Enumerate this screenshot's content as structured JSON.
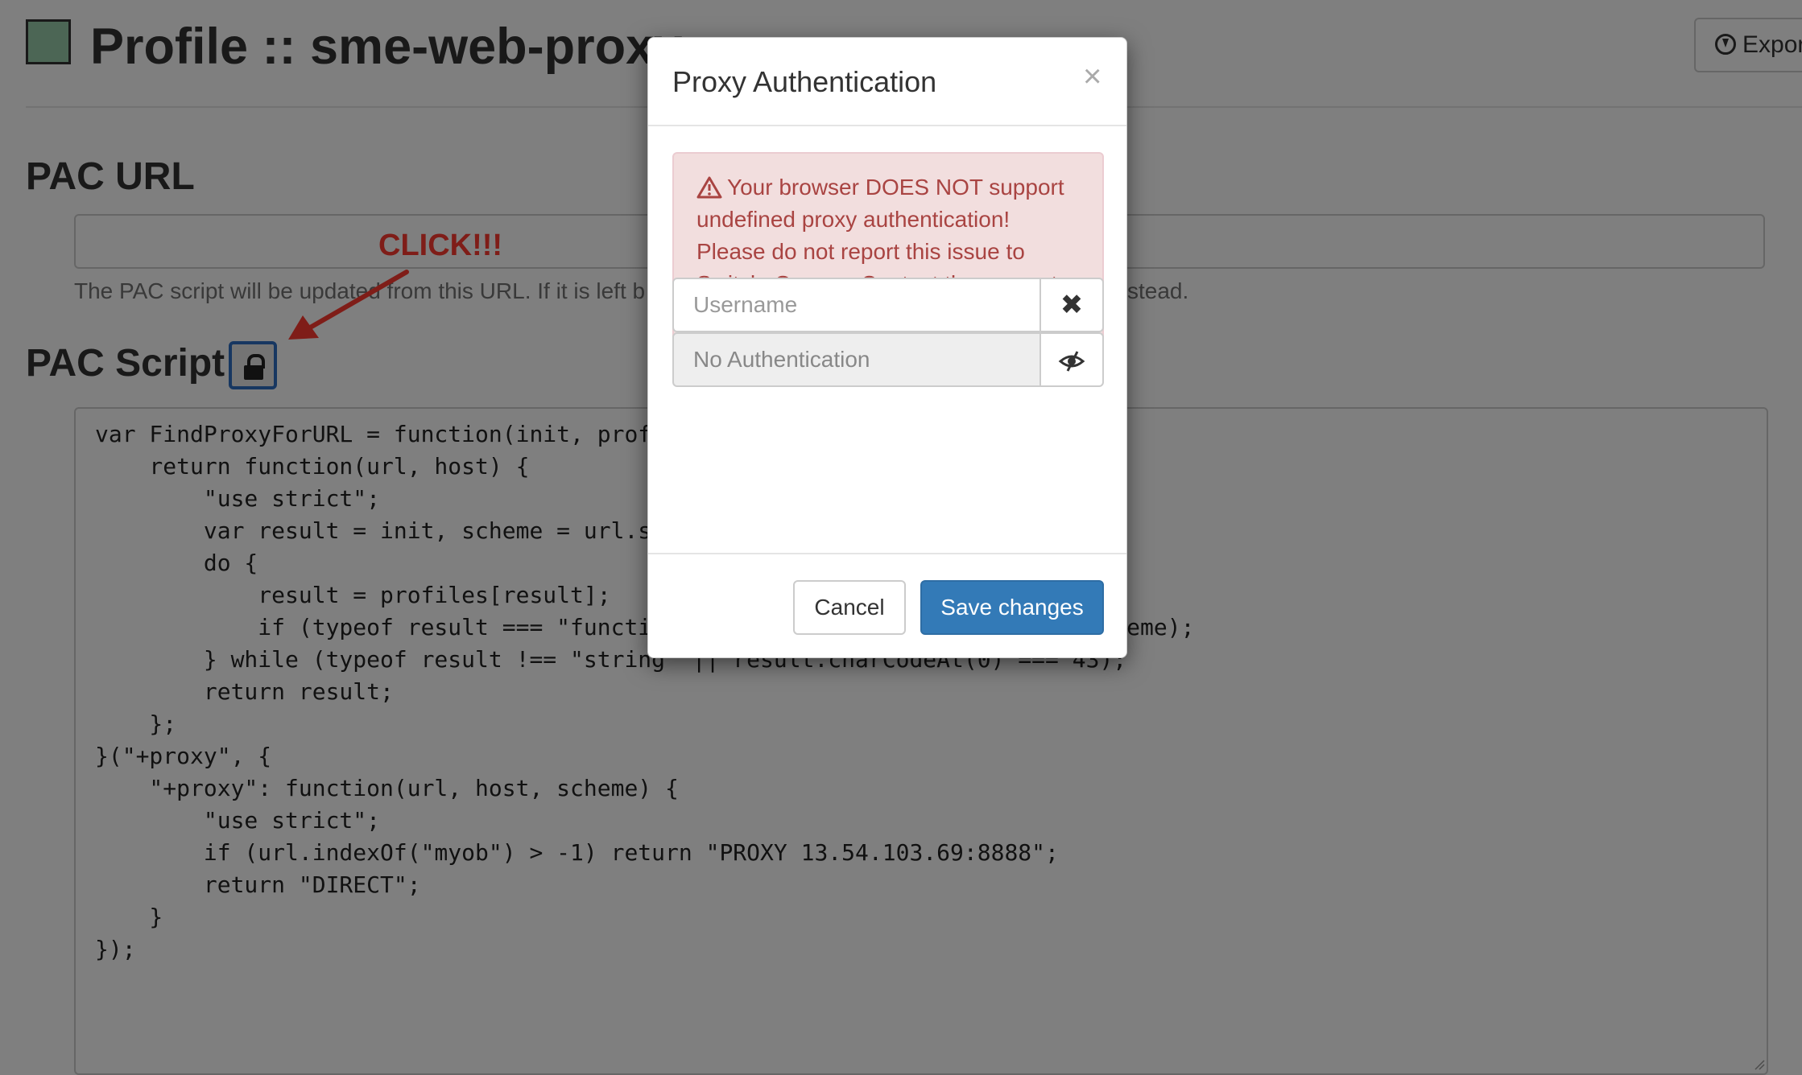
{
  "header": {
    "title": "Profile :: sme-web-proxy",
    "profile_color": "#99ccaa",
    "export_label": "Expor",
    "export_icon": "download-circle-icon"
  },
  "pac_url": {
    "heading": "PAC URL",
    "value": "",
    "help_text": "The PAC script will be updated from this URL. If it is left b",
    "help_text_tail": "stead."
  },
  "pac_script": {
    "heading": "PAC Script",
    "lock_icon": "lock-icon",
    "code": "var FindProxyForURL = function(init, profiles) {\n    return function(url, host) {\n        \"use strict\";\n        var result = init, scheme = url.substr(0, url.indexOf(\":\"));\n        do {\n            result = profiles[result];\n            if (typeof result === \"function\") result = result(url, host, scheme);\n        } while (typeof result !== \"string\" || result.charCodeAt(0) === 43);\n        return result;\n    };\n}(\"+proxy\", {\n    \"+proxy\": function(url, host, scheme) {\n        \"use strict\";\n        if (url.indexOf(\"myob\") > -1) return \"PROXY 13.54.103.69:8888\";\n        return \"DIRECT\";\n    }\n});"
  },
  "annotation": {
    "click_label": "CLICK!!!",
    "color": "#ff3b30"
  },
  "modal": {
    "title": "Proxy Authentication",
    "close_symbol": "×",
    "alert_text": "Your browser DOES NOT support undefined proxy authentication! Please do not report this issue to SwitchyOmega. Contact the support for your browser instead.",
    "alert_icon": "warning-triangle-icon",
    "username_placeholder": "Username",
    "username_clear_symbol": "✖",
    "password_placeholder": "No Authentication",
    "password_toggle_icon": "eye-slash-icon",
    "cancel_label": "Cancel",
    "save_label": "Save changes"
  },
  "colors": {
    "alert_bg": "#f2dede",
    "alert_text": "#a94442",
    "primary": "#337ab7"
  }
}
